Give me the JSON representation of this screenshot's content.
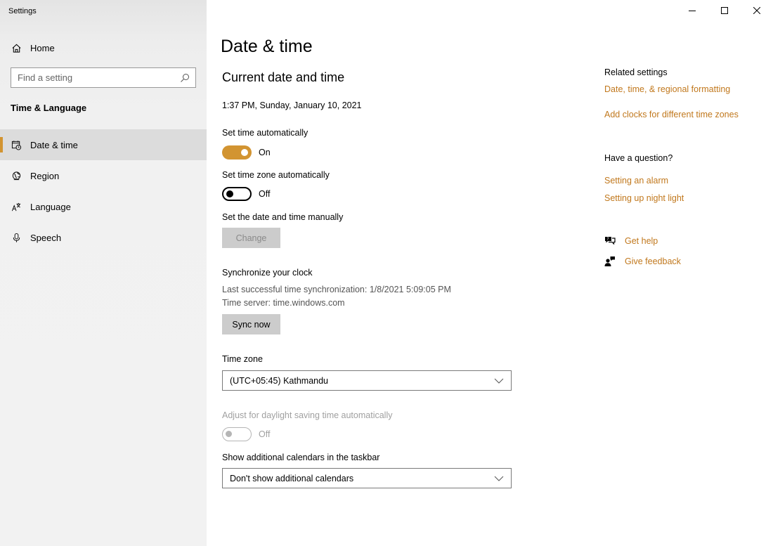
{
  "window": {
    "app_title": "Settings",
    "controls": {
      "minimize": "minimize-icon",
      "maximize": "maximize-icon",
      "close": "close-icon"
    }
  },
  "sidebar": {
    "home_label": "Home",
    "search_placeholder": "Find a setting",
    "section_header": "Time & Language",
    "items": [
      {
        "label": "Date & time",
        "icon": "calendar-clock-icon",
        "active": true
      },
      {
        "label": "Region",
        "icon": "globe-icon",
        "active": false
      },
      {
        "label": "Language",
        "icon": "language-icon",
        "active": false
      },
      {
        "label": "Speech",
        "icon": "microphone-icon",
        "active": false
      }
    ]
  },
  "main": {
    "title": "Date & time",
    "current_header": "Current date and time",
    "current_value": "1:37 PM, Sunday, January 10, 2021",
    "set_time_auto": {
      "label": "Set time automatically",
      "state": "On"
    },
    "set_zone_auto": {
      "label": "Set time zone automatically",
      "state": "Off"
    },
    "manual": {
      "label": "Set the date and time manually",
      "button": "Change"
    },
    "sync": {
      "header": "Synchronize your clock",
      "last_sync": "Last successful time synchronization: 1/8/2021 5:09:05 PM",
      "server": "Time server: time.windows.com",
      "button": "Sync now"
    },
    "timezone": {
      "label": "Time zone",
      "value": "(UTC+05:45) Kathmandu"
    },
    "dst": {
      "label": "Adjust for daylight saving time automatically",
      "state": "Off"
    },
    "calendars": {
      "label": "Show additional calendars in the taskbar",
      "value": "Don't show additional calendars"
    }
  },
  "related": {
    "header": "Related settings",
    "links": [
      "Date, time, & regional formatting",
      "Add clocks for different time zones"
    ]
  },
  "question": {
    "header": "Have a question?",
    "links": [
      "Setting an alarm",
      "Setting up night light"
    ]
  },
  "help": {
    "get_help": "Get help",
    "feedback": "Give feedback"
  },
  "colors": {
    "accent": "#d29431",
    "link": "#c1781d"
  }
}
